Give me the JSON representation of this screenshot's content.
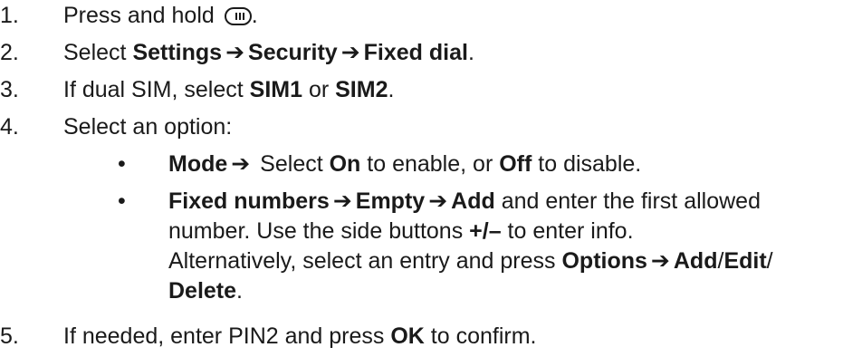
{
  "steps": [
    {
      "num": "1.",
      "text": "Press and hold",
      "icon": "menu-key-icon",
      "after": "."
    },
    {
      "num": "2.",
      "pre": "Select ",
      "b1": "Settings",
      "b2": "Security",
      "b3": "Fixed dial",
      "post": "."
    },
    {
      "num": "3.",
      "pre": "If dual SIM, select ",
      "b1": "SIM1",
      "mid": " or ",
      "b2": "SIM2",
      "post": "."
    },
    {
      "num": "4.",
      "text": "Select an option:"
    },
    {
      "num": "5.",
      "pre": "If needed, enter PIN2 and press ",
      "b1": "OK",
      "post": " to confirm."
    }
  ],
  "options": [
    {
      "bullet": "•",
      "b1": "Mode",
      "pre": " Select ",
      "b2": "On",
      "mid": " to enable, or ",
      "b3": "Off",
      "post": " to disable."
    },
    {
      "bullet": "•",
      "b1": "Fixed numbers",
      "b2": "Empty",
      "b3": "Add",
      "line1_post": " and enter the first allowed",
      "line2_pre": "number. Use the side buttons ",
      "line2_b": "+/–",
      "line2_post": " to enter info.",
      "line3_pre": "Alternatively, select an entry and press ",
      "line3_b1": "Options",
      "line3_b2": "Add",
      "line3_sep": "/",
      "line3_b3": "Edit",
      "line3_end": "/",
      "line4_b": "Delete",
      "line4_post": "."
    }
  ],
  "arrow": "➔"
}
